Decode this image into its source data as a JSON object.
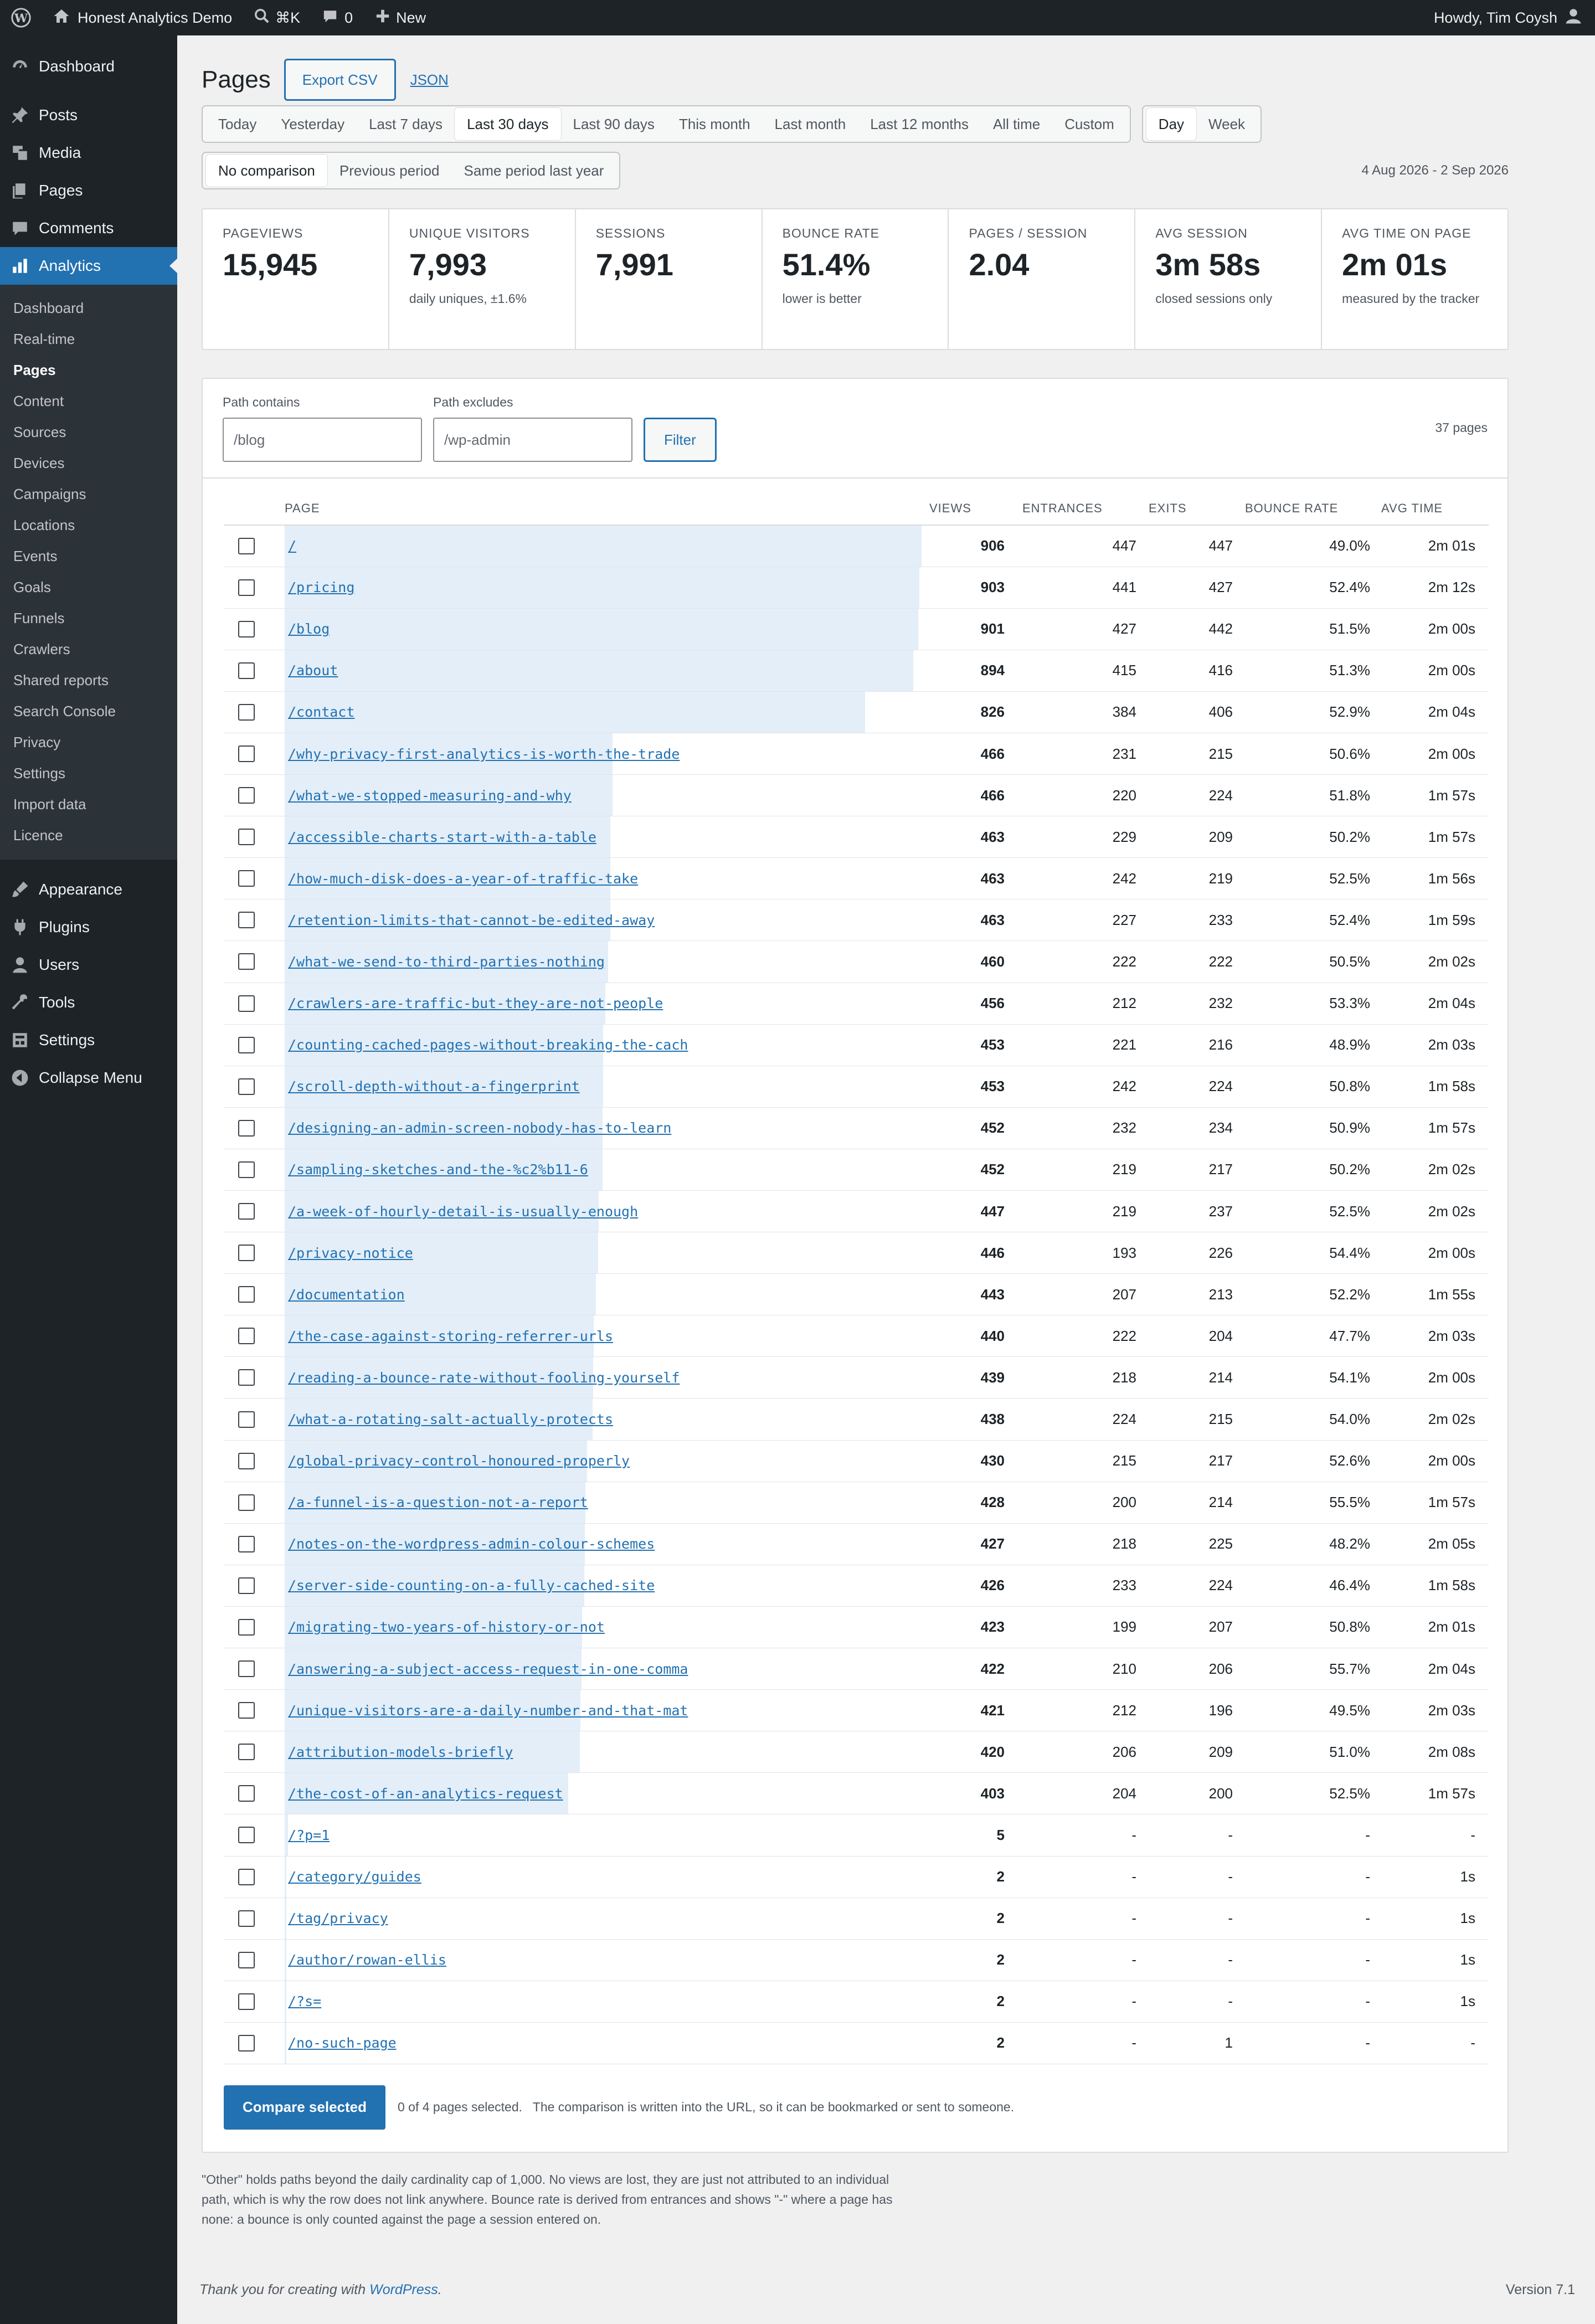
{
  "adminbar": {
    "site_name": "Honest Analytics Demo",
    "search_shortcut": "⌘K",
    "comments_count": "0",
    "new_label": "New",
    "howdy": "Howdy, Tim Coysh"
  },
  "sidebar": {
    "top_items": [
      {
        "label": "Dashboard",
        "icon": "dashboard-icon"
      },
      {
        "label": "Posts",
        "icon": "pin-icon"
      },
      {
        "label": "Media",
        "icon": "media-icon"
      },
      {
        "label": "Pages",
        "icon": "pages-icon"
      },
      {
        "label": "Comments",
        "icon": "comment-icon"
      },
      {
        "label": "Analytics",
        "icon": "chart-bar-icon"
      }
    ],
    "analytics_submenu": [
      "Dashboard",
      "Real-time",
      "Pages",
      "Content",
      "Sources",
      "Devices",
      "Campaigns",
      "Locations",
      "Events",
      "Goals",
      "Funnels",
      "Crawlers",
      "Shared reports",
      "Search Console",
      "Privacy",
      "Settings",
      "Import data",
      "Licence"
    ],
    "bottom_items": [
      {
        "label": "Appearance",
        "icon": "brush-icon"
      },
      {
        "label": "Plugins",
        "icon": "plugin-icon"
      },
      {
        "label": "Users",
        "icon": "user-icon"
      },
      {
        "label": "Tools",
        "icon": "wrench-icon"
      },
      {
        "label": "Settings",
        "icon": "settings-icon"
      },
      {
        "label": "Collapse Menu",
        "icon": "collapse-icon"
      }
    ]
  },
  "header": {
    "title": "Pages",
    "export_csv": "Export CSV",
    "json": "JSON"
  },
  "periods": [
    "Today",
    "Yesterday",
    "Last 7 days",
    "Last 30 days",
    "Last 90 days",
    "This month",
    "Last month",
    "Last 12 months",
    "All time",
    "Custom"
  ],
  "active_period": "Last 30 days",
  "granularity": [
    "Day",
    "Week"
  ],
  "comparison": [
    "No comparison",
    "Previous period",
    "Same period last year"
  ],
  "date_range": "4 Aug 2026 - 2 Sep 2026",
  "stats": [
    {
      "label": "PAGEVIEWS",
      "value": "15,945",
      "note": ""
    },
    {
      "label": "UNIQUE VISITORS",
      "value": "7,993",
      "note": "daily uniques, ±1.6%"
    },
    {
      "label": "SESSIONS",
      "value": "7,991",
      "note": ""
    },
    {
      "label": "BOUNCE RATE",
      "value": "51.4%",
      "note": "lower is better"
    },
    {
      "label": "PAGES / SESSION",
      "value": "2.04",
      "note": ""
    },
    {
      "label": "AVG SESSION",
      "value": "3m 58s",
      "note": "closed sessions only"
    },
    {
      "label": "AVG TIME ON PAGE",
      "value": "2m 01s",
      "note": "measured by the tracker"
    }
  ],
  "filters": {
    "contains_label": "Path contains",
    "contains_placeholder": "/blog",
    "excludes_label": "Path excludes",
    "excludes_placeholder": "/wp-admin",
    "button": "Filter",
    "count": "37 pages"
  },
  "table": {
    "headers": [
      "PAGE",
      "VIEWS",
      "ENTRANCES",
      "EXITS",
      "BOUNCE RATE",
      "AVG TIME"
    ],
    "max_views": 906,
    "rows": [
      {
        "path": "/",
        "views": "906",
        "entrances": "447",
        "exits": "447",
        "bounce": "49.0%",
        "time": "2m 01s"
      },
      {
        "path": "/pricing",
        "views": "903",
        "entrances": "441",
        "exits": "427",
        "bounce": "52.4%",
        "time": "2m 12s"
      },
      {
        "path": "/blog",
        "views": "901",
        "entrances": "427",
        "exits": "442",
        "bounce": "51.5%",
        "time": "2m 00s"
      },
      {
        "path": "/about",
        "views": "894",
        "entrances": "415",
        "exits": "416",
        "bounce": "51.3%",
        "time": "2m 00s"
      },
      {
        "path": "/contact",
        "views": "826",
        "entrances": "384",
        "exits": "406",
        "bounce": "52.9%",
        "time": "2m 04s"
      },
      {
        "path": "/why-privacy-first-analytics-is-worth-the-trade",
        "views": "466",
        "entrances": "231",
        "exits": "215",
        "bounce": "50.6%",
        "time": "2m 00s"
      },
      {
        "path": "/what-we-stopped-measuring-and-why",
        "views": "466",
        "entrances": "220",
        "exits": "224",
        "bounce": "51.8%",
        "time": "1m 57s"
      },
      {
        "path": "/accessible-charts-start-with-a-table",
        "views": "463",
        "entrances": "229",
        "exits": "209",
        "bounce": "50.2%",
        "time": "1m 57s"
      },
      {
        "path": "/how-much-disk-does-a-year-of-traffic-take",
        "views": "463",
        "entrances": "242",
        "exits": "219",
        "bounce": "52.5%",
        "time": "1m 56s"
      },
      {
        "path": "/retention-limits-that-cannot-be-edited-away",
        "views": "463",
        "entrances": "227",
        "exits": "233",
        "bounce": "52.4%",
        "time": "1m 59s"
      },
      {
        "path": "/what-we-send-to-third-parties-nothing",
        "views": "460",
        "entrances": "222",
        "exits": "222",
        "bounce": "50.5%",
        "time": "2m 02s"
      },
      {
        "path": "/crawlers-are-traffic-but-they-are-not-people",
        "views": "456",
        "entrances": "212",
        "exits": "232",
        "bounce": "53.3%",
        "time": "2m 04s"
      },
      {
        "path": "/counting-cached-pages-without-breaking-the-cach",
        "views": "453",
        "entrances": "221",
        "exits": "216",
        "bounce": "48.9%",
        "time": "2m 03s"
      },
      {
        "path": "/scroll-depth-without-a-fingerprint",
        "views": "453",
        "entrances": "242",
        "exits": "224",
        "bounce": "50.8%",
        "time": "1m 58s"
      },
      {
        "path": "/designing-an-admin-screen-nobody-has-to-learn",
        "views": "452",
        "entrances": "232",
        "exits": "234",
        "bounce": "50.9%",
        "time": "1m 57s"
      },
      {
        "path": "/sampling-sketches-and-the-%c2%b11-6",
        "views": "452",
        "entrances": "219",
        "exits": "217",
        "bounce": "50.2%",
        "time": "2m 02s"
      },
      {
        "path": "/a-week-of-hourly-detail-is-usually-enough",
        "views": "447",
        "entrances": "219",
        "exits": "237",
        "bounce": "52.5%",
        "time": "2m 02s"
      },
      {
        "path": "/privacy-notice",
        "views": "446",
        "entrances": "193",
        "exits": "226",
        "bounce": "54.4%",
        "time": "2m 00s"
      },
      {
        "path": "/documentation",
        "views": "443",
        "entrances": "207",
        "exits": "213",
        "bounce": "52.2%",
        "time": "1m 55s"
      },
      {
        "path": "/the-case-against-storing-referrer-urls",
        "views": "440",
        "entrances": "222",
        "exits": "204",
        "bounce": "47.7%",
        "time": "2m 03s"
      },
      {
        "path": "/reading-a-bounce-rate-without-fooling-yourself",
        "views": "439",
        "entrances": "218",
        "exits": "214",
        "bounce": "54.1%",
        "time": "2m 00s"
      },
      {
        "path": "/what-a-rotating-salt-actually-protects",
        "views": "438",
        "entrances": "224",
        "exits": "215",
        "bounce": "54.0%",
        "time": "2m 02s"
      },
      {
        "path": "/global-privacy-control-honoured-properly",
        "views": "430",
        "entrances": "215",
        "exits": "217",
        "bounce": "52.6%",
        "time": "2m 00s"
      },
      {
        "path": "/a-funnel-is-a-question-not-a-report",
        "views": "428",
        "entrances": "200",
        "exits": "214",
        "bounce": "55.5%",
        "time": "1m 57s"
      },
      {
        "path": "/notes-on-the-wordpress-admin-colour-schemes",
        "views": "427",
        "entrances": "218",
        "exits": "225",
        "bounce": "48.2%",
        "time": "2m 05s"
      },
      {
        "path": "/server-side-counting-on-a-fully-cached-site",
        "views": "426",
        "entrances": "233",
        "exits": "224",
        "bounce": "46.4%",
        "time": "1m 58s"
      },
      {
        "path": "/migrating-two-years-of-history-or-not",
        "views": "423",
        "entrances": "199",
        "exits": "207",
        "bounce": "50.8%",
        "time": "2m 01s"
      },
      {
        "path": "/answering-a-subject-access-request-in-one-comma",
        "views": "422",
        "entrances": "210",
        "exits": "206",
        "bounce": "55.7%",
        "time": "2m 04s"
      },
      {
        "path": "/unique-visitors-are-a-daily-number-and-that-mat",
        "views": "421",
        "entrances": "212",
        "exits": "196",
        "bounce": "49.5%",
        "time": "2m 03s"
      },
      {
        "path": "/attribution-models-briefly",
        "views": "420",
        "entrances": "206",
        "exits": "209",
        "bounce": "51.0%",
        "time": "2m 08s"
      },
      {
        "path": "/the-cost-of-an-analytics-request",
        "views": "403",
        "entrances": "204",
        "exits": "200",
        "bounce": "52.5%",
        "time": "1m 57s"
      },
      {
        "path": "/?p=1",
        "views": "5",
        "entrances": "-",
        "exits": "-",
        "bounce": "-",
        "time": "-"
      },
      {
        "path": "/category/guides",
        "views": "2",
        "entrances": "-",
        "exits": "-",
        "bounce": "-",
        "time": "1s"
      },
      {
        "path": "/tag/privacy",
        "views": "2",
        "entrances": "-",
        "exits": "-",
        "bounce": "-",
        "time": "1s"
      },
      {
        "path": "/author/rowan-ellis",
        "views": "2",
        "entrances": "-",
        "exits": "-",
        "bounce": "-",
        "time": "1s"
      },
      {
        "path": "/?s=",
        "views": "2",
        "entrances": "-",
        "exits": "-",
        "bounce": "-",
        "time": "1s"
      },
      {
        "path": "/no-such-page",
        "views": "2",
        "entrances": "-",
        "exits": "1",
        "bounce": "-",
        "time": "-"
      }
    ]
  },
  "compare": {
    "button": "Compare selected",
    "selection_text": "0 of 4 pages selected.   The comparison is written into the URL, so it can be bookmarked or sent to someone."
  },
  "note": "\"Other\" holds paths beyond the daily cardinality cap of 1,000. No views are lost, they are just not attributed to an individual path, which is why the row does not link anywhere. Bounce rate is derived from entrances and shows \"-\" where a page has none: a bounce is only counted against the page a session entered on.",
  "footer": {
    "thanks_prefix": "Thank you for creating with ",
    "thanks_link": "WordPress",
    "thanks_suffix": ".",
    "version": "Version 7.1"
  },
  "colors": {
    "accent": "#2271b1",
    "sidebar": "#1d2327",
    "bar": "#e3eef8"
  }
}
